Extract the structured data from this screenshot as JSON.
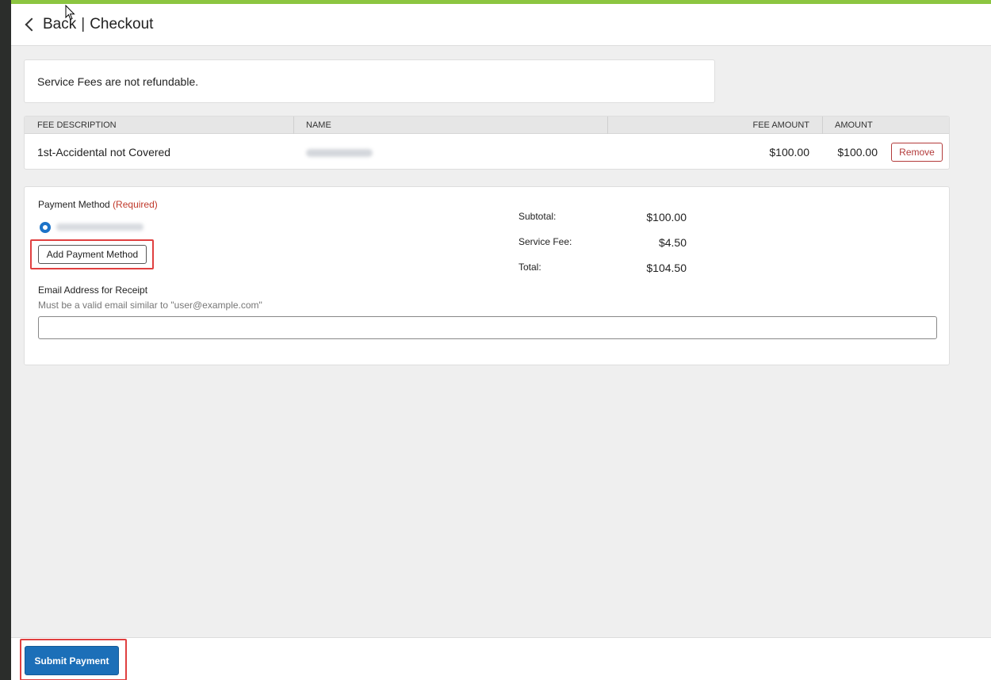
{
  "header": {
    "back_label": "Back",
    "separator": "|",
    "title": "Checkout"
  },
  "notice": {
    "text": "Service Fees are not refundable."
  },
  "fees_table": {
    "columns": [
      "FEE DESCRIPTION",
      "NAME",
      "FEE AMOUNT",
      "AMOUNT"
    ],
    "rows": [
      {
        "description": "1st-Accidental not Covered",
        "fee_amount": "$100.00",
        "amount": "$100.00",
        "remove_label": "Remove"
      }
    ]
  },
  "payment": {
    "method_label": "Payment Method",
    "required_label": "(Required)",
    "add_button_label": "Add Payment Method",
    "summary": [
      {
        "label": "Subtotal:",
        "value": "$100.00"
      },
      {
        "label": "Service Fee:",
        "value": "$4.50"
      },
      {
        "label": "Total:",
        "value": "$104.50"
      }
    ],
    "email_label": "Email Address for Receipt",
    "email_help": "Must be a valid email similar to \"user@example.com\"",
    "email_value": ""
  },
  "footer": {
    "submit_label": "Submit Payment"
  },
  "colors": {
    "accent_bar": "#8cc540",
    "primary_button": "#1c6fb8",
    "remove_red": "#b33b3b",
    "highlight_red": "#e04040"
  }
}
